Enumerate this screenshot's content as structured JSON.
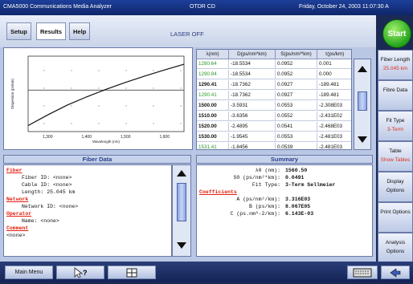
{
  "app": {
    "title": "CMA5000 Communications Media Analyzer",
    "module": "OTDR CD",
    "datetime": "Friday, October 24, 2003 11:07:30 A"
  },
  "tabs": [
    "Setup",
    "Results",
    "Help"
  ],
  "status": "LASER OFF",
  "start_label": "Start",
  "chart_data": {
    "type": "line",
    "x": [
      1250,
      1300,
      1350,
      1400,
      1450,
      1500,
      1550,
      1600,
      1650
    ],
    "y": [
      -18.8,
      -13.2,
      -8.0,
      -3.6,
      0.4,
      4.1,
      7.5,
      10.7,
      13.7
    ],
    "xlim": [
      1250,
      1650
    ],
    "ylim": [
      -22,
      18
    ],
    "xticks": [
      "1,300",
      "1,400",
      "1,500",
      "1,600"
    ],
    "xlabel": "Wavelength (nm)",
    "ylabel": "Dispersion (ps/nm)",
    "hline": 0
  },
  "table": {
    "headers": [
      "λ(nm)",
      "D(ps/nm*km)",
      "S(ps/nm²*km)",
      "τ(ps/km)"
    ],
    "rows": [
      [
        "1280.64",
        "-18.5534",
        "0.0952",
        "0.001"
      ],
      [
        "1290.84",
        "-18.5534",
        "0.0952",
        "0.000"
      ],
      [
        "1290.41",
        "-18.7362",
        "0.0927",
        "-189.481"
      ],
      [
        "1290.41",
        "-18.7362",
        "0.0927",
        "-189.481"
      ],
      [
        "1500.00",
        "-3.5931",
        "0.0553",
        "-2.308E03"
      ],
      [
        "1510.00",
        "-3.6356",
        "0.0552",
        "-2.431E02"
      ],
      [
        "1520.00",
        "-2.4895",
        "0.0541",
        "-2.468E03"
      ],
      [
        "1530.00",
        "-1.9545",
        "0.0553",
        "-2.481E03"
      ],
      [
        "1531.41",
        "-1.8456",
        "0.0539",
        "-2.481E03"
      ]
    ],
    "green_rows": [
      0,
      1,
      3,
      8
    ]
  },
  "fiber_data": {
    "header": "Fiber Data",
    "sections": [
      {
        "title": "Fiber",
        "lines": [
          [
            "Fiber ID:",
            "<none>"
          ],
          [
            "Cable ID:",
            "<none>"
          ],
          [
            "Length:",
            "25.045 km"
          ]
        ]
      },
      {
        "title": "Network",
        "lines": [
          [
            "Network ID:",
            "<none>"
          ]
        ]
      },
      {
        "title": "Operator",
        "lines": [
          [
            "Name:",
            "<none>"
          ]
        ]
      },
      {
        "title": "Comment",
        "lines": [
          [
            "",
            "<none>"
          ]
        ]
      }
    ]
  },
  "summary": {
    "header": "Summary",
    "lines": [
      [
        "λ0 (nm):",
        "1560.50"
      ],
      [
        "S0 (ps/nm²*km):",
        "0.0491"
      ],
      [
        "Fit Type:",
        "3-Term Sellmeier"
      ]
    ],
    "coef_title": "Coefficients",
    "coefs": [
      [
        "A (ps/nm²/km):",
        "3.316E03"
      ],
      [
        "B (ps/km):",
        "8.067E05"
      ],
      [
        "C (ps.nm^-2/km):",
        "6.143E-03"
      ]
    ]
  },
  "side": [
    {
      "label": "Fiber Length",
      "sub": "25.045 km"
    },
    {
      "label": "Fibre Data",
      "sub": ""
    },
    {
      "label": "Fit Type",
      "sub": "3-Term"
    },
    {
      "label": "Table",
      "sub": "Show Tables"
    },
    {
      "label": "Display Options",
      "sub": ""
    },
    {
      "label": "Print Options",
      "sub": ""
    },
    {
      "label": "Analysis Options",
      "sub": ""
    }
  ],
  "bottom": {
    "main_menu": "Main Menu"
  }
}
